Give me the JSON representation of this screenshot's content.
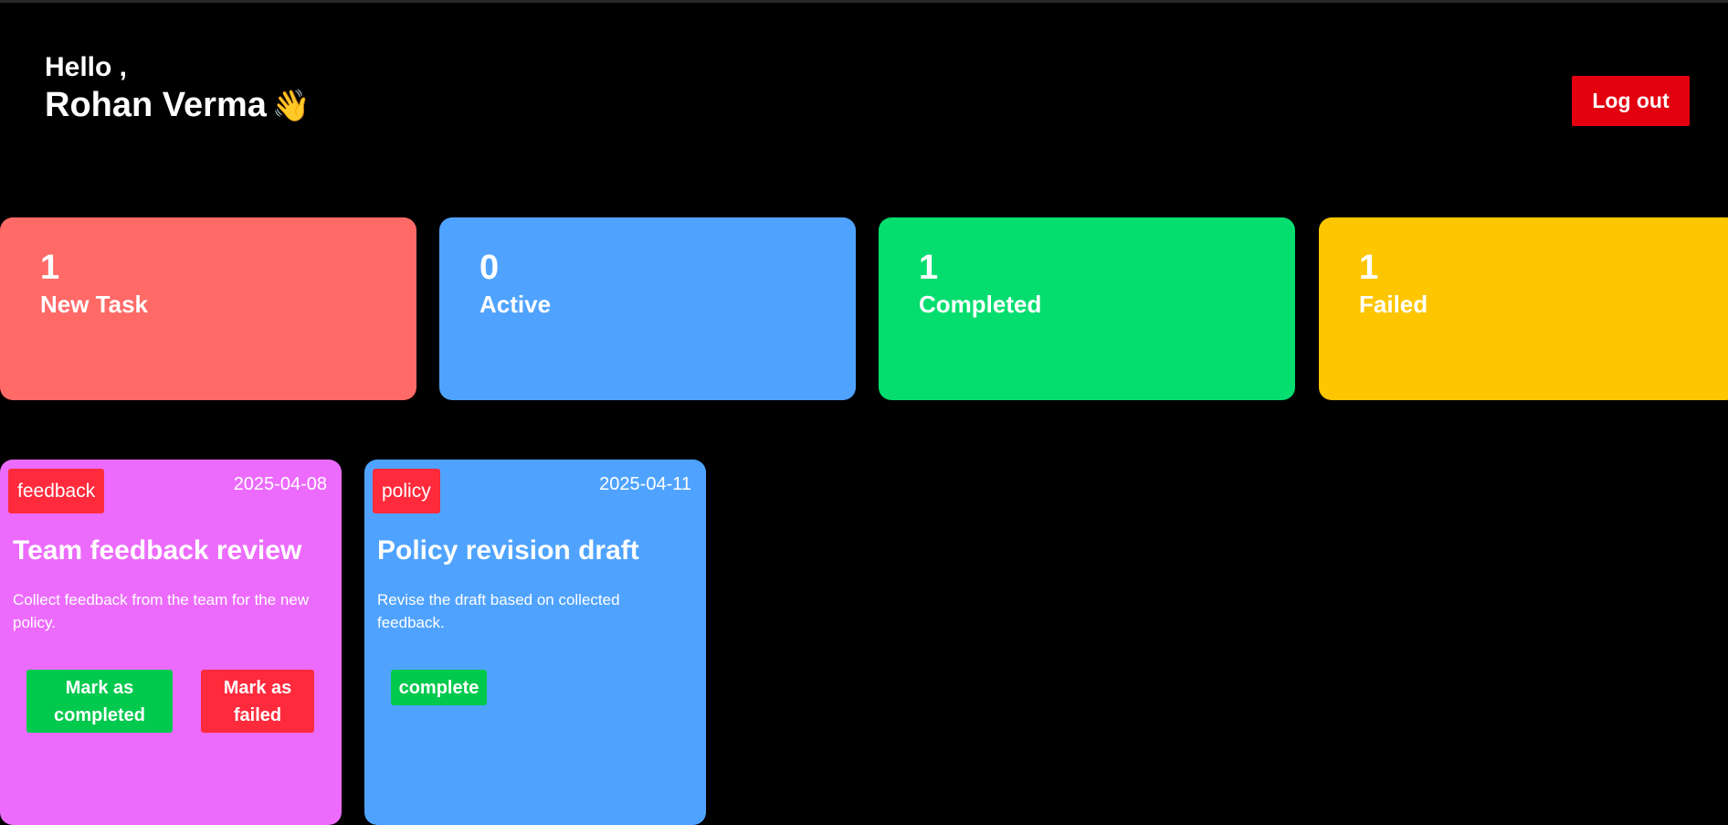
{
  "header": {
    "greeting": "Hello ,",
    "user_name": "Rohan Verma",
    "wave_emoji": "👋",
    "logout_label": "Log out"
  },
  "stats": [
    {
      "count": "1",
      "label": "New Task",
      "color": "#ff6a67"
    },
    {
      "count": "0",
      "label": "Active",
      "color": "#4fa3ff"
    },
    {
      "count": "1",
      "label": "Completed",
      "color": "#05de6f"
    },
    {
      "count": "1",
      "label": "Failed",
      "color": "#fec600"
    }
  ],
  "tasks": [
    {
      "category": "feedback",
      "date": "2025-04-08",
      "title": "Team feedback review",
      "description": "Collect feedback from the team for the new policy.",
      "color": "#ec6bfc",
      "mark_completed_label": "Mark as completed",
      "mark_failed_label": "Mark as failed"
    },
    {
      "category": "policy",
      "date": "2025-04-11",
      "title": "Policy revision draft",
      "description": "Revise the draft based on collected feedback.",
      "color": "#4fa3ff",
      "status_label": "complete"
    }
  ],
  "colors": {
    "background": "#000000",
    "logout": "#e3000f",
    "tag": "#ff2a3c",
    "success_button": "#00c94d",
    "failure_button": "#ff2a3c"
  }
}
